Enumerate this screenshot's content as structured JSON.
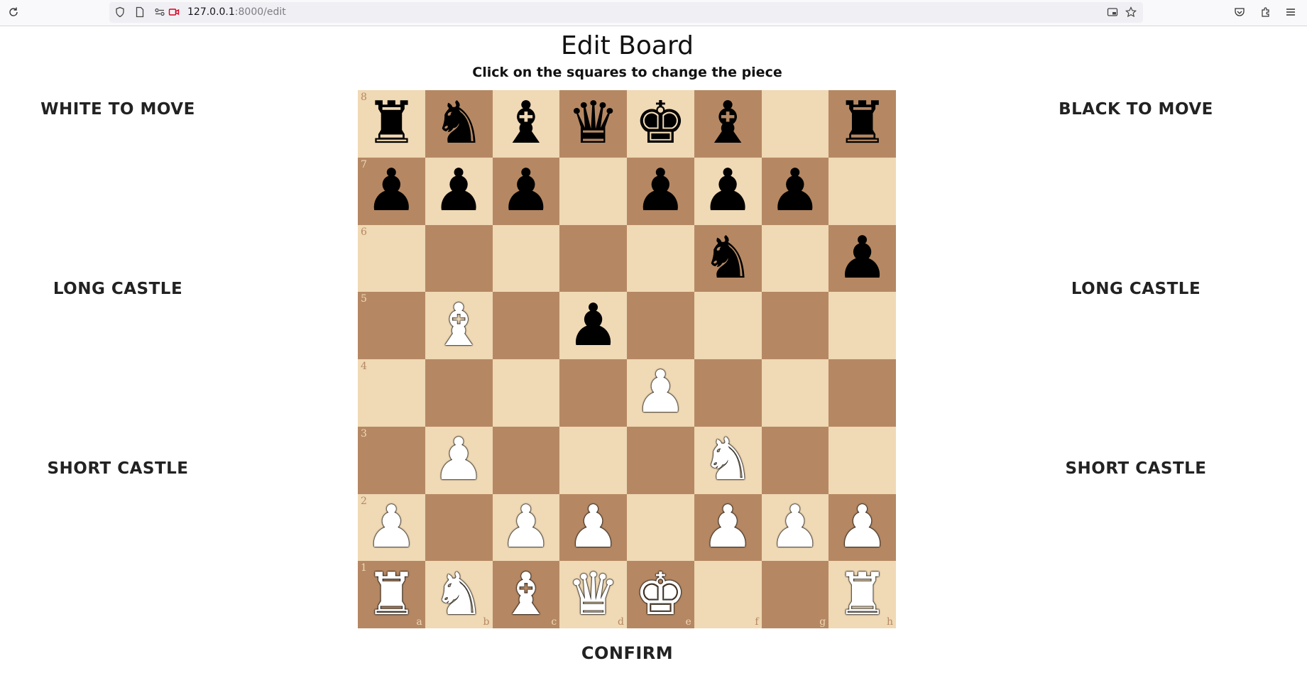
{
  "browser": {
    "url_host": "127.0.0.1",
    "url_rest": ":8000/edit"
  },
  "page": {
    "title": "Edit Board",
    "subtitle": "Click on the squares to change the piece",
    "left_buttons": [
      "WHITE TO MOVE",
      "LONG CASTLE",
      "SHORT CASTLE"
    ],
    "right_buttons": [
      "BLACK TO MOVE",
      "LONG CASTLE",
      "SHORT CASTLE"
    ],
    "confirm_label": "CONFIRM"
  },
  "board": {
    "files": [
      "a",
      "b",
      "c",
      "d",
      "e",
      "f",
      "g",
      "h"
    ],
    "ranks": [
      "8",
      "7",
      "6",
      "5",
      "4",
      "3",
      "2",
      "1"
    ],
    "position": [
      [
        "r",
        "n",
        "b",
        "q",
        "k",
        "b",
        "",
        "r"
      ],
      [
        "p",
        "p",
        "p",
        "",
        "p",
        "p",
        "p",
        ""
      ],
      [
        "",
        "",
        "",
        "",
        "",
        "n",
        "",
        "p"
      ],
      [
        "",
        "B",
        "",
        "p",
        "",
        "",
        "",
        ""
      ],
      [
        "",
        "",
        "",
        "",
        "P",
        "",
        "",
        ""
      ],
      [
        "",
        "P",
        "",
        "",
        "",
        "N",
        "",
        ""
      ],
      [
        "P",
        "",
        "P",
        "P",
        "",
        "P",
        "P",
        "P"
      ],
      [
        "R",
        "N",
        "B",
        "Q",
        "K",
        "",
        "",
        "R"
      ]
    ],
    "colors": {
      "light": "#f0d9b5",
      "dark": "#b58863"
    }
  }
}
